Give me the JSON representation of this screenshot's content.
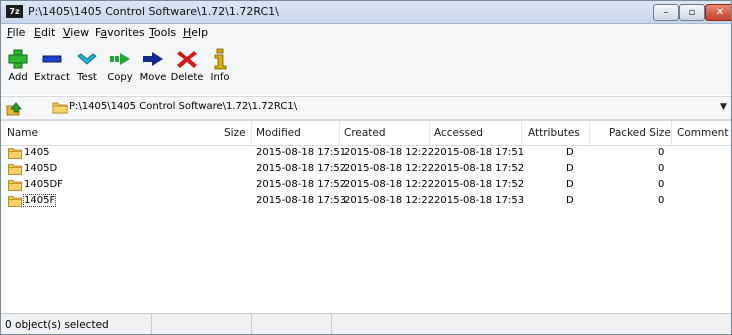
{
  "window": {
    "app_icon_label": "7z",
    "title": "P:\\1405\\1405 Control Software\\1.72\\1.72RC1\\",
    "controls": {
      "minimize": "–",
      "maximize": "▫",
      "close": "✕"
    }
  },
  "menu": [
    {
      "mnemonic": "F",
      "rest": "ile"
    },
    {
      "mnemonic": "E",
      "rest": "dit"
    },
    {
      "mnemonic": "V",
      "rest": "iew"
    },
    {
      "pre": "F",
      "mnemonic": "a",
      "rest": "vorites"
    },
    {
      "mnemonic": "T",
      "rest": "ools"
    },
    {
      "mnemonic": "H",
      "rest": "elp"
    }
  ],
  "toolbar": {
    "add": "Add",
    "extract": "Extract",
    "test": "Test",
    "copy": "Copy",
    "move": "Move",
    "delete": "Delete",
    "info": "Info",
    "colors": {
      "add": "#2db52d",
      "extract": "#1d3fc7",
      "test": "#22b3d6",
      "copy": "#1ea83a",
      "move": "#0f2a8c",
      "delete": "#d11b1b",
      "info": "#d8b000"
    }
  },
  "address": {
    "path": "P:\\1405\\1405 Control Software\\1.72\\1.72RC1\\",
    "dropdown_icon": "▼"
  },
  "columns": {
    "name": "Name",
    "size": "Size",
    "modified": "Modified",
    "created": "Created",
    "accessed": "Accessed",
    "attributes": "Attributes",
    "packed_size": "Packed Size",
    "comment": "Comment"
  },
  "rows": [
    {
      "name": "1405",
      "size": "",
      "modified": "2015-08-18 17:51",
      "created": "2015-08-18 12:22",
      "accessed": "2015-08-18 17:51",
      "attributes": "D",
      "packed_size": "0",
      "comment": ""
    },
    {
      "name": "1405D",
      "size": "",
      "modified": "2015-08-18 17:52",
      "created": "2015-08-18 12:22",
      "accessed": "2015-08-18 17:52",
      "attributes": "D",
      "packed_size": "0",
      "comment": ""
    },
    {
      "name": "1405DF",
      "size": "",
      "modified": "2015-08-18 17:52",
      "created": "2015-08-18 12:22",
      "accessed": "2015-08-18 17:52",
      "attributes": "D",
      "packed_size": "0",
      "comment": ""
    },
    {
      "name": "1405F",
      "size": "",
      "modified": "2015-08-18 17:53",
      "created": "2015-08-18 12:22",
      "accessed": "2015-08-18 17:53",
      "attributes": "D",
      "packed_size": "0",
      "comment": ""
    }
  ],
  "status": {
    "selected": "0 object(s) selected"
  },
  "icons": {
    "folder": "folder-icon",
    "up": "up-folder-icon"
  }
}
